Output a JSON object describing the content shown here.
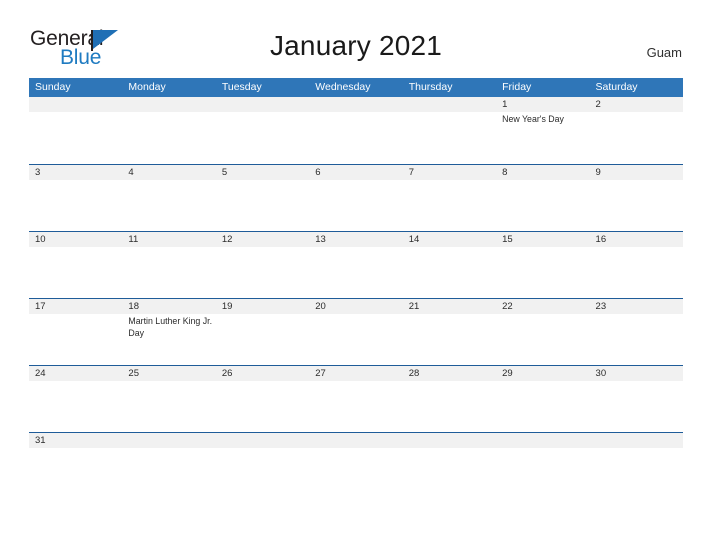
{
  "brand": {
    "name_part1": "General",
    "name_part2": "Blue",
    "flag_icon": "flag-triangle-icon"
  },
  "header": {
    "title": "January 2021",
    "region": "Guam"
  },
  "colors": {
    "header_blue": "#2f76b8",
    "separator_blue": "#1f5c99",
    "band_gray": "#f1f1f1",
    "brand_blue": "#1f7bc1",
    "text_dark": "#2b2b2b"
  },
  "calendar": {
    "day_headers": [
      "Sunday",
      "Monday",
      "Tuesday",
      "Wednesday",
      "Thursday",
      "Friday",
      "Saturday"
    ],
    "weeks": [
      {
        "days": [
          {
            "date": "",
            "events": []
          },
          {
            "date": "",
            "events": []
          },
          {
            "date": "",
            "events": []
          },
          {
            "date": "",
            "events": []
          },
          {
            "date": "",
            "events": []
          },
          {
            "date": "1",
            "events": [
              "New Year's Day"
            ]
          },
          {
            "date": "2",
            "events": []
          }
        ]
      },
      {
        "days": [
          {
            "date": "3",
            "events": []
          },
          {
            "date": "4",
            "events": []
          },
          {
            "date": "5",
            "events": []
          },
          {
            "date": "6",
            "events": []
          },
          {
            "date": "7",
            "events": []
          },
          {
            "date": "8",
            "events": []
          },
          {
            "date": "9",
            "events": []
          }
        ]
      },
      {
        "days": [
          {
            "date": "10",
            "events": []
          },
          {
            "date": "11",
            "events": []
          },
          {
            "date": "12",
            "events": []
          },
          {
            "date": "13",
            "events": []
          },
          {
            "date": "14",
            "events": []
          },
          {
            "date": "15",
            "events": []
          },
          {
            "date": "16",
            "events": []
          }
        ]
      },
      {
        "days": [
          {
            "date": "17",
            "events": []
          },
          {
            "date": "18",
            "events": [
              "Martin Luther King Jr. Day"
            ]
          },
          {
            "date": "19",
            "events": []
          },
          {
            "date": "20",
            "events": []
          },
          {
            "date": "21",
            "events": []
          },
          {
            "date": "22",
            "events": []
          },
          {
            "date": "23",
            "events": []
          }
        ]
      },
      {
        "days": [
          {
            "date": "24",
            "events": []
          },
          {
            "date": "25",
            "events": []
          },
          {
            "date": "26",
            "events": []
          },
          {
            "date": "27",
            "events": []
          },
          {
            "date": "28",
            "events": []
          },
          {
            "date": "29",
            "events": []
          },
          {
            "date": "30",
            "events": []
          }
        ]
      },
      {
        "days": [
          {
            "date": "31",
            "events": []
          },
          {
            "date": "",
            "events": []
          },
          {
            "date": "",
            "events": []
          },
          {
            "date": "",
            "events": []
          },
          {
            "date": "",
            "events": []
          },
          {
            "date": "",
            "events": []
          },
          {
            "date": "",
            "events": []
          }
        ]
      }
    ]
  }
}
